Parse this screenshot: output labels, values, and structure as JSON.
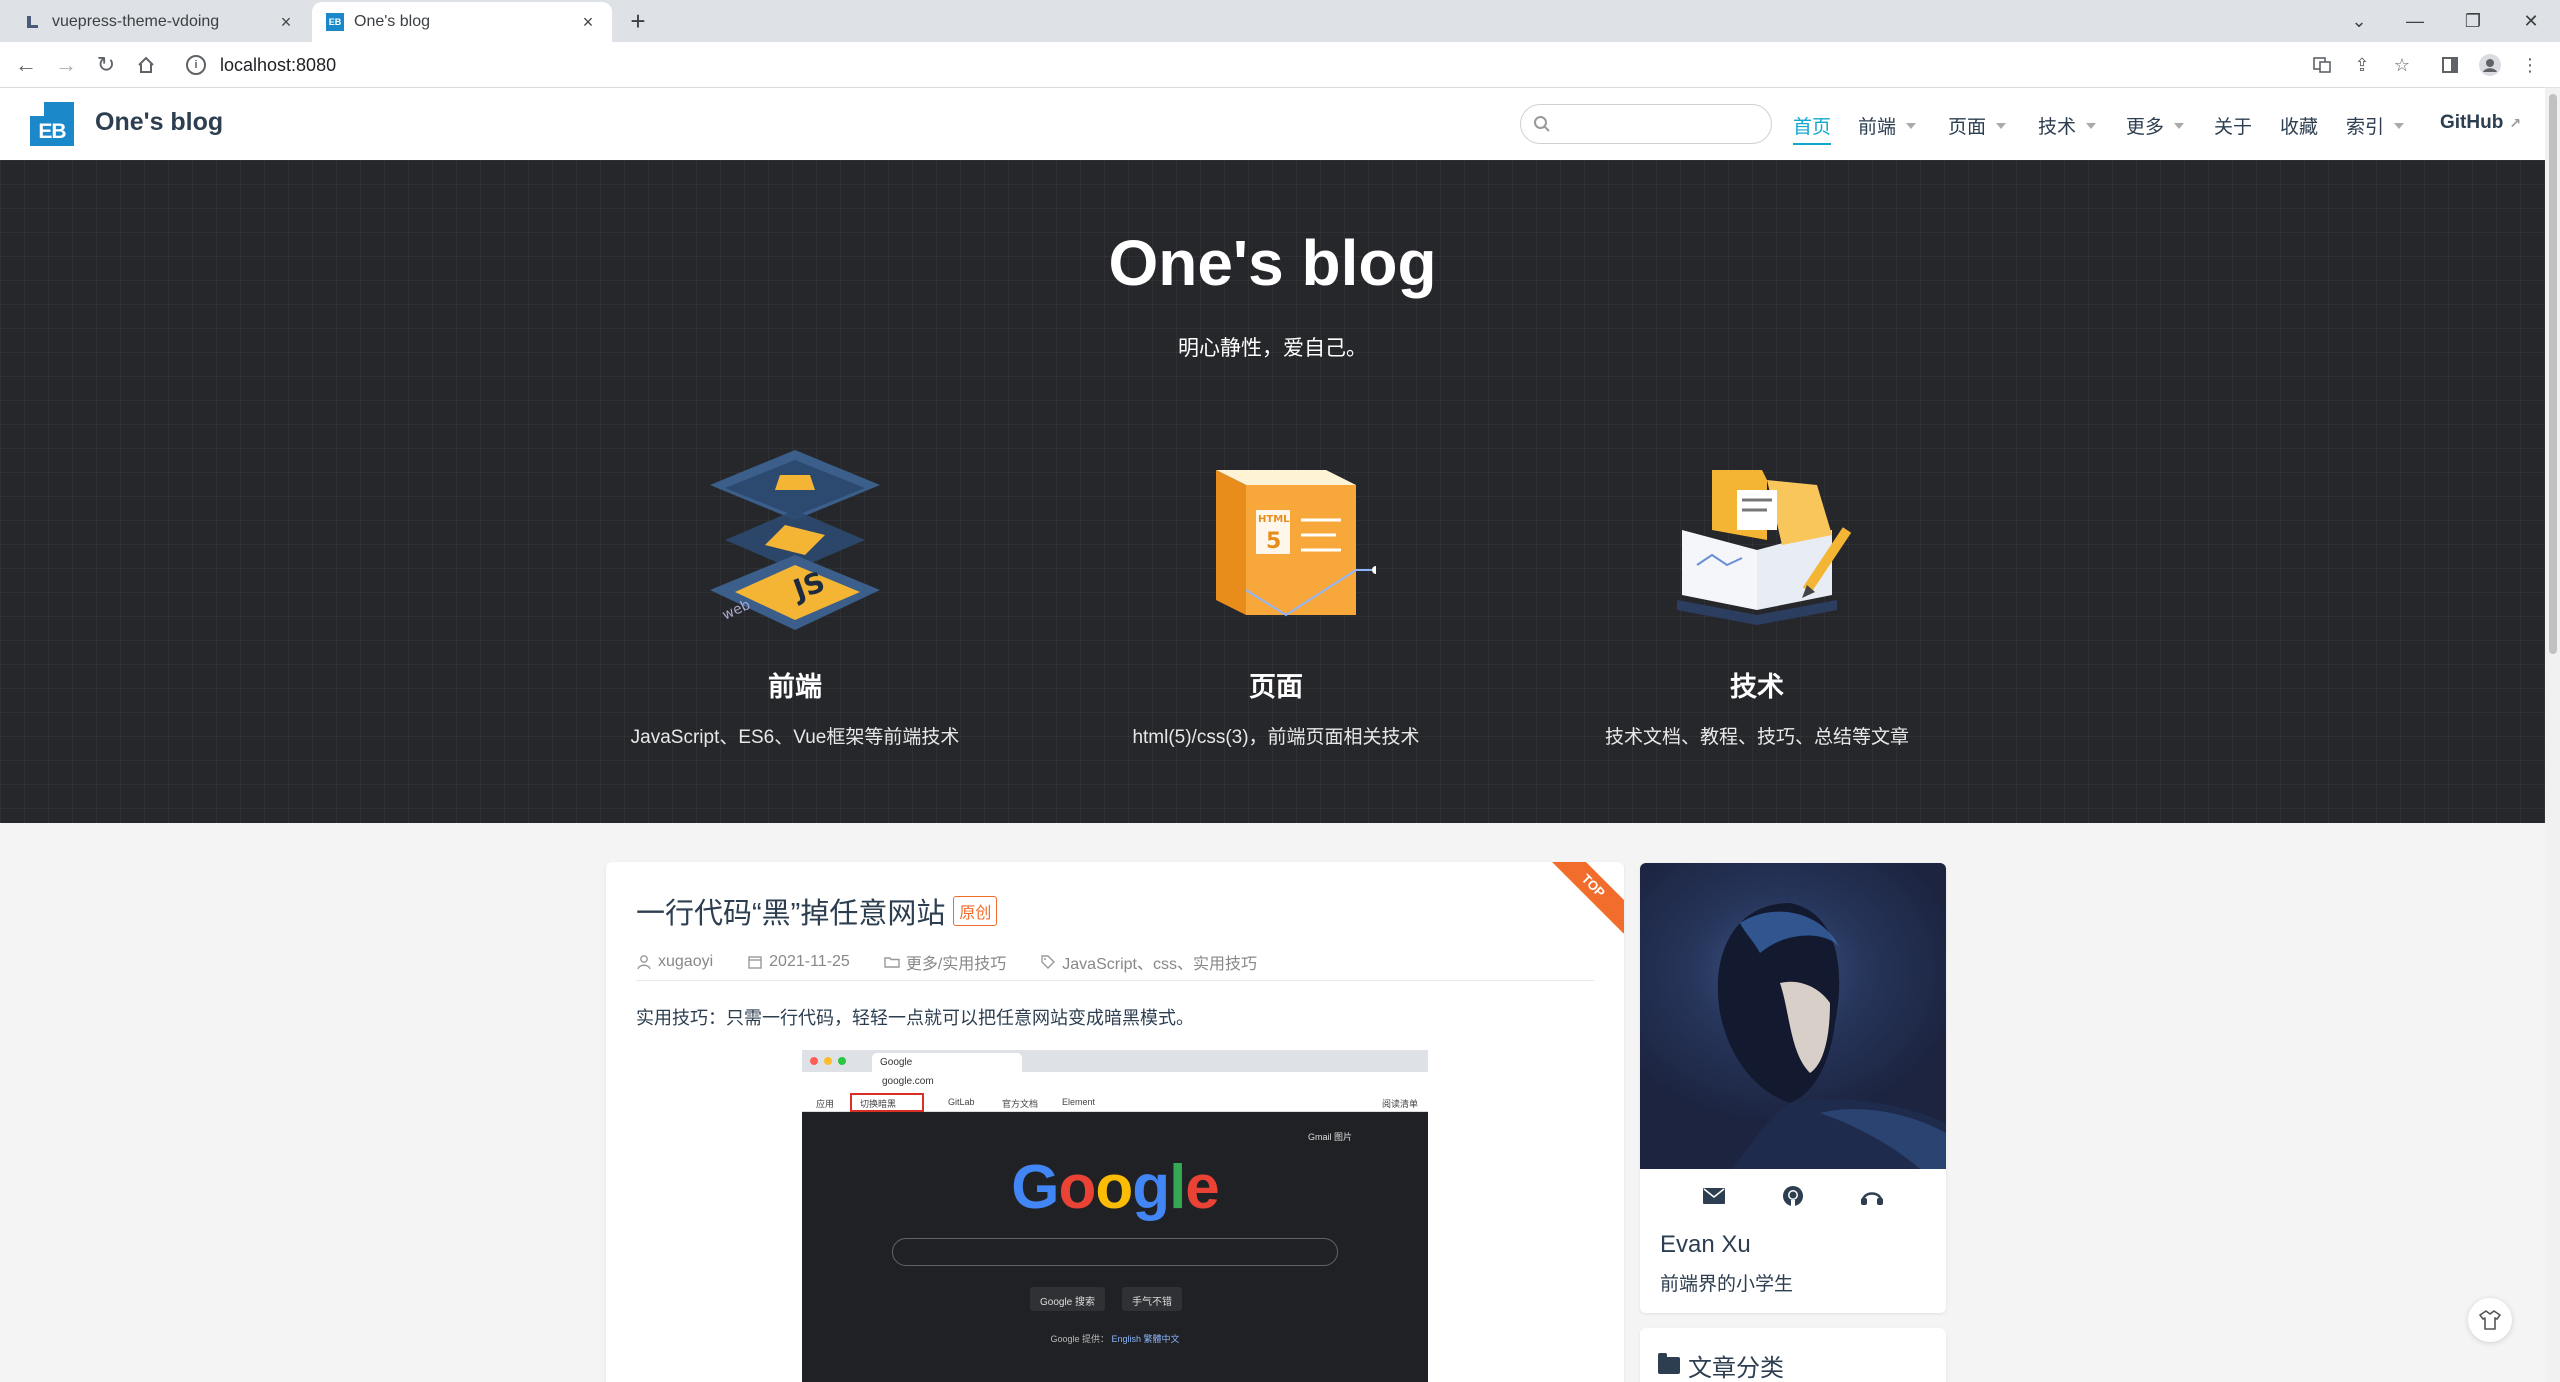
{
  "browser": {
    "tabs": [
      {
        "title": "vuepress-theme-vdoing",
        "active": false
      },
      {
        "title": "One's blog",
        "active": true
      }
    ],
    "url": "localhost:8080"
  },
  "site": {
    "logo_text": "EB",
    "name": "One's blog",
    "nav": [
      {
        "label": "首页",
        "active": true,
        "dropdown": false
      },
      {
        "label": "前端",
        "dropdown": true
      },
      {
        "label": "页面",
        "dropdown": true
      },
      {
        "label": "技术",
        "dropdown": true
      },
      {
        "label": "更多",
        "dropdown": true
      },
      {
        "label": "关于",
        "dropdown": false
      },
      {
        "label": "收藏",
        "dropdown": false
      },
      {
        "label": "索引",
        "dropdown": true
      },
      {
        "label": "GitHub",
        "external": true
      }
    ]
  },
  "hero": {
    "title": "One's blog",
    "subtitle": "明心静性，爱自己。",
    "features": [
      {
        "title": "前端",
        "desc": "JavaScript、ES6、Vue框架等前端技术",
        "icon": "web-js-icon"
      },
      {
        "title": "页面",
        "desc": "html(5)/css(3)，前端页面相关技术",
        "icon": "html5-icon"
      },
      {
        "title": "技术",
        "desc": "技术文档、教程、技巧、总结等文章",
        "icon": "book-icon"
      }
    ]
  },
  "post": {
    "ribbon": "TOP",
    "title": "一行代码“黑”掉任意网站",
    "badge": "原创",
    "author": "xugaoyi",
    "date": "2021-11-25",
    "category": "更多/实用技巧",
    "tags": "JavaScript、css、实用技巧",
    "excerpt": "实用技巧：只需一行代码，轻轻一点就可以把任意网站变成暗黑模式。",
    "screenshot": {
      "tab": "Google",
      "url": "google.com",
      "bookmarks": [
        "应用",
        "切换暗黑",
        "GitLab",
        "官方文档",
        "Element",
        "阅读清单"
      ],
      "top_links": "Gmail  图片",
      "logo": "Google",
      "btn1": "Google 搜索",
      "btn2": "手气不错",
      "lang_prefix": "Google 提供：",
      "lang_links": "English  繁體中文"
    }
  },
  "profile": {
    "name": "Evan Xu",
    "bio": "前端界的小学生"
  },
  "categories": {
    "title": "文章分类"
  },
  "colors": {
    "accent": "#11a8cd",
    "hero_bg": "#26272b",
    "ribbon": "#f26d2b"
  }
}
